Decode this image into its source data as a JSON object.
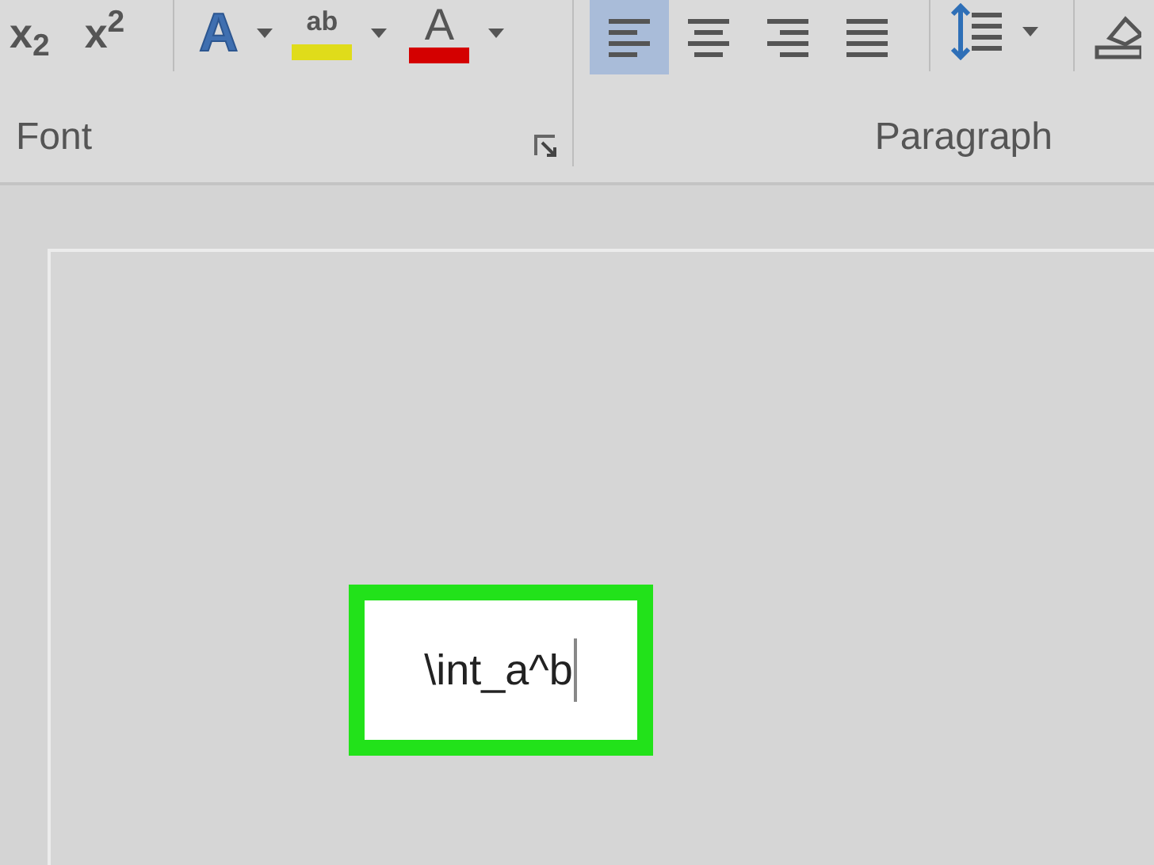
{
  "ribbon": {
    "font_group": {
      "label": "Font",
      "script_buttons": [
        {
          "label": "x$_{2}$"
        },
        {
          "label": "x$^{2}$"
        }
      ],
      "color_buttons": [
        {
          "kind": "effects",
          "label": "A"
        },
        {
          "kind": "highlight",
          "label": "ab",
          "color": "#e0dc1a"
        },
        {
          "kind": "fontcolor",
          "label": "A",
          "color": "#d40000"
        }
      ]
    },
    "paragraph_group": {
      "label": "Paragraph",
      "align_buttons": [
        {
          "kind": "left",
          "selected": true
        },
        {
          "kind": "center",
          "selected": false
        },
        {
          "kind": "right",
          "selected": false
        },
        {
          "kind": "justify",
          "selected": false
        }
      ]
    }
  },
  "document": {
    "equation": {
      "value": "\\int_a^b"
    }
  }
}
